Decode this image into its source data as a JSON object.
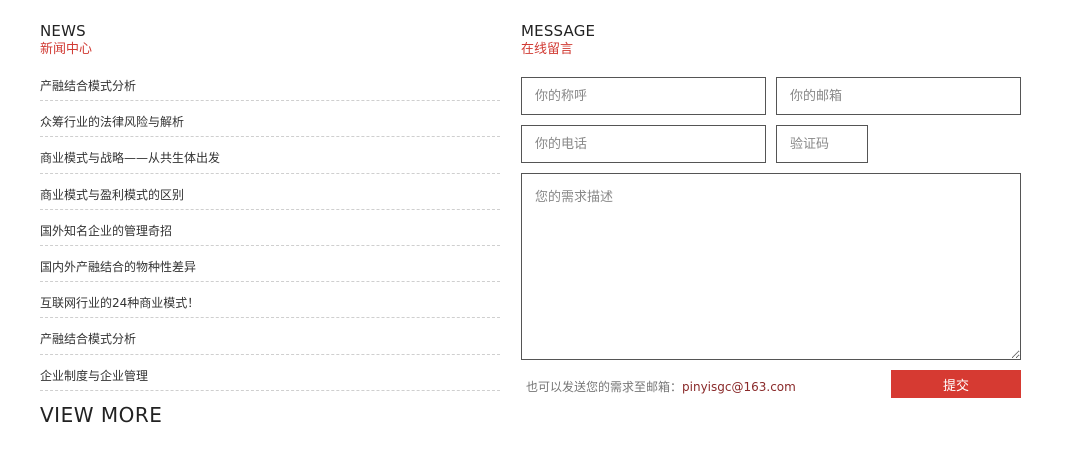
{
  "news": {
    "title_en": "NEWS",
    "title_cn": "新闻中心",
    "items": [
      "产融结合模式分析",
      "众筹行业的法律风险与解析",
      "商业模式与战略——从共生体出发",
      "商业模式与盈利模式的区别",
      "国外知名企业的管理奇招",
      "国内外产融结合的物种性差异",
      "互联网行业的24种商业模式！",
      "产融结合模式分析",
      "企业制度与企业管理"
    ],
    "view_more": "VIEW MORE"
  },
  "message": {
    "title_en": "MESSAGE",
    "title_cn": "在线留言",
    "name_placeholder": "你的称呼",
    "email_placeholder": "你的邮箱",
    "phone_placeholder": "你的电话",
    "code_placeholder": "验证码",
    "desc_placeholder": "您的需求描述",
    "tip_text": "也可以发送您的需求至邮箱：",
    "tip_email": "pinyisgc@163.com",
    "submit_label": "提交"
  },
  "colors": {
    "accent": "#d13a33",
    "button": "#d63a32"
  }
}
